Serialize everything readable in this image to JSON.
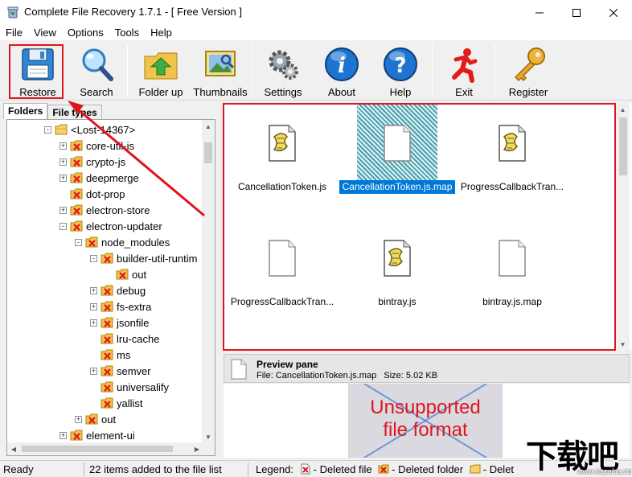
{
  "window": {
    "title": "Complete File Recovery 1.7.1 - [ Free Version ]",
    "icons": {
      "app": "app-recycle-icon",
      "minimize": "minimize-icon",
      "maximize": "maximize-icon",
      "close": "close-icon"
    }
  },
  "menu": [
    "File",
    "View",
    "Options",
    "Tools",
    "Help"
  ],
  "toolbar": {
    "restore": "Restore",
    "search": "Search",
    "folder_up": "Folder up",
    "thumbnails": "Thumbnails",
    "settings": "Settings",
    "about": "About",
    "help": "Help",
    "exit": "Exit",
    "register": "Register"
  },
  "left_panel": {
    "tabs": [
      "Folders",
      "File types"
    ],
    "tree": [
      {
        "label": "<Lost-14367>",
        "level": 0,
        "expander": "-",
        "icon": "open-folder"
      },
      {
        "label": "core-util-is",
        "level": 1,
        "expander": "+",
        "icon": "deleted-folder"
      },
      {
        "label": "crypto-js",
        "level": 1,
        "expander": "+",
        "icon": "deleted-folder"
      },
      {
        "label": "deepmerge",
        "level": 1,
        "expander": "+",
        "icon": "deleted-folder"
      },
      {
        "label": "dot-prop",
        "level": 1,
        "expander": "",
        "icon": "deleted-folder"
      },
      {
        "label": "electron-store",
        "level": 1,
        "expander": "+",
        "icon": "deleted-folder"
      },
      {
        "label": "electron-updater",
        "level": 1,
        "expander": "-",
        "icon": "deleted-folder"
      },
      {
        "label": "node_modules",
        "level": 2,
        "expander": "-",
        "icon": "deleted-folder"
      },
      {
        "label": "builder-util-runtim",
        "level": 3,
        "expander": "-",
        "icon": "deleted-folder"
      },
      {
        "label": "out",
        "level": 4,
        "expander": "",
        "icon": "deleted-folder"
      },
      {
        "label": "debug",
        "level": 3,
        "expander": "+",
        "icon": "deleted-folder"
      },
      {
        "label": "fs-extra",
        "level": 3,
        "expander": "+",
        "icon": "deleted-folder"
      },
      {
        "label": "jsonfile",
        "level": 3,
        "expander": "+",
        "icon": "deleted-folder"
      },
      {
        "label": "lru-cache",
        "level": 3,
        "expander": "",
        "icon": "deleted-folder"
      },
      {
        "label": "ms",
        "level": 3,
        "expander": "",
        "icon": "deleted-folder"
      },
      {
        "label": "semver",
        "level": 3,
        "expander": "+",
        "icon": "deleted-folder"
      },
      {
        "label": "universalify",
        "level": 3,
        "expander": "",
        "icon": "deleted-folder"
      },
      {
        "label": "yallist",
        "level": 3,
        "expander": "",
        "icon": "deleted-folder"
      },
      {
        "label": "out",
        "level": 2,
        "expander": "+",
        "icon": "deleted-folder"
      },
      {
        "label": "element-ui",
        "level": 1,
        "expander": "+",
        "icon": "deleted-folder"
      }
    ]
  },
  "files": [
    {
      "name": "CancellationToken.js",
      "icon": "script-file",
      "selected": false
    },
    {
      "name": "CancellationToken.js.map",
      "icon": "blank-file",
      "selected": true
    },
    {
      "name": "ProgressCallbackTran...",
      "icon": "script-file",
      "selected": false
    },
    {
      "name": "ProgressCallbackTran...",
      "icon": "blank-file",
      "selected": false
    },
    {
      "name": "bintray.js",
      "icon": "script-file",
      "selected": false
    },
    {
      "name": "bintray.js.map",
      "icon": "blank-file",
      "selected": false
    }
  ],
  "preview": {
    "title": "Preview pane",
    "file_label": "File:",
    "file_name": "CancellationToken.js.map",
    "size_label": "Size:",
    "size": "5.02 KB",
    "unsupported_line1": "Unsupported",
    "unsupported_line2": "file format"
  },
  "status": {
    "ready": "Ready",
    "items": "22 items added to the file list",
    "legend": "Legend:",
    "deleted_file": "- Deleted file",
    "deleted_folder": "- Deleted folder",
    "deleted_trunc": "- Delet"
  },
  "watermark": {
    "main": "下载吧",
    "url": "www.xiazaiba.com"
  },
  "colors": {
    "highlight_red": "#e0141e",
    "selection_blue": "#0078d7",
    "status_bg": "#f0f0f0"
  }
}
